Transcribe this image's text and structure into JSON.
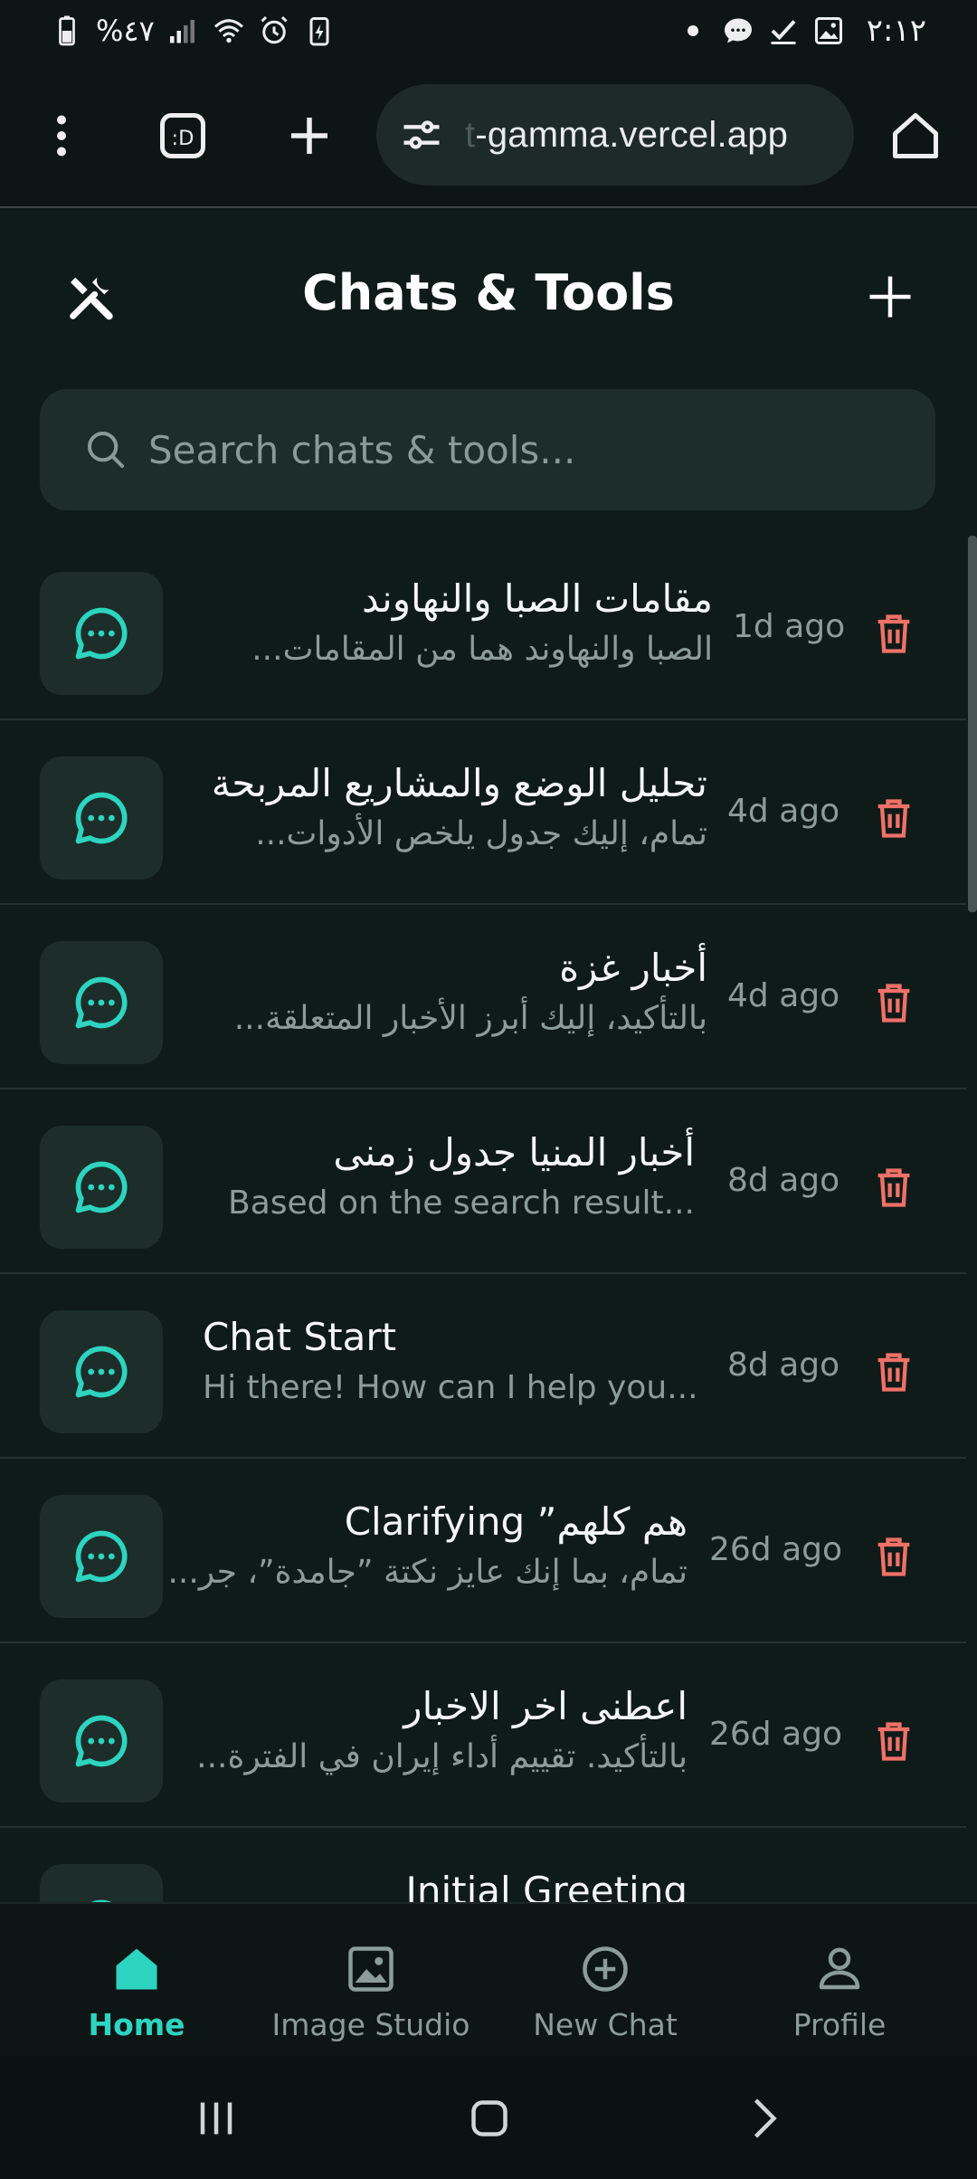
{
  "status_bar": {
    "time": "٢:١٢",
    "battery_percent": "%٤٧",
    "icons_left": [
      "battery-icon",
      "signal-icon",
      "wifi-icon",
      "alarm-icon",
      "battery-saver-icon"
    ],
    "icons_right": [
      "dot-icon",
      "message-icon",
      "check-icon",
      "image-icon"
    ]
  },
  "browser": {
    "url_faded_prefix": "t",
    "url": "-gamma.vercel.app"
  },
  "header": {
    "title": "Chats & Tools"
  },
  "search": {
    "placeholder": "Search chats & tools..."
  },
  "chats": [
    {
      "title": "مقامات الصبا والنهاوند",
      "preview": "الصبا والنهاوند هما من المقامات...",
      "time": "1d ago"
    },
    {
      "title": "تحليل الوضع والمشاريع المربحة",
      "preview": "تمام، إليك جدول يلخص الأدوات...",
      "time": "4d ago"
    },
    {
      "title": "أخبار غزة",
      "preview": "بالتأكيد، إليك أبرز الأخبار المتعلقة...",
      "time": "4d ago"
    },
    {
      "title": "أخبار المنيا جدول زمنى",
      "preview": "Based on the search result...",
      "time": "8d ago"
    },
    {
      "title": "Chat Start",
      "preview": "Hi there! How can I help you...",
      "time": "8d ago"
    },
    {
      "title": "هم كلهم” Clarifying",
      "preview": "تمام، بما إنك عايز نكتة ”جامدة”، جر...",
      "time": "26d ago"
    },
    {
      "title": "اعطنى اخر الاخبار",
      "preview": "بالتأكيد. تقييم أداء إيران في الفترة...",
      "time": "26d ago"
    },
    {
      "title": "Initial Greeting",
      "preview": "",
      "time": ""
    }
  ],
  "nav": {
    "home": "Home",
    "image_studio": "Image Studio",
    "new_chat": "New Chat",
    "profile": "Profile"
  },
  "colors": {
    "accent": "#2dd4bf",
    "delete": "#f07167",
    "background": "#0f1b19"
  }
}
